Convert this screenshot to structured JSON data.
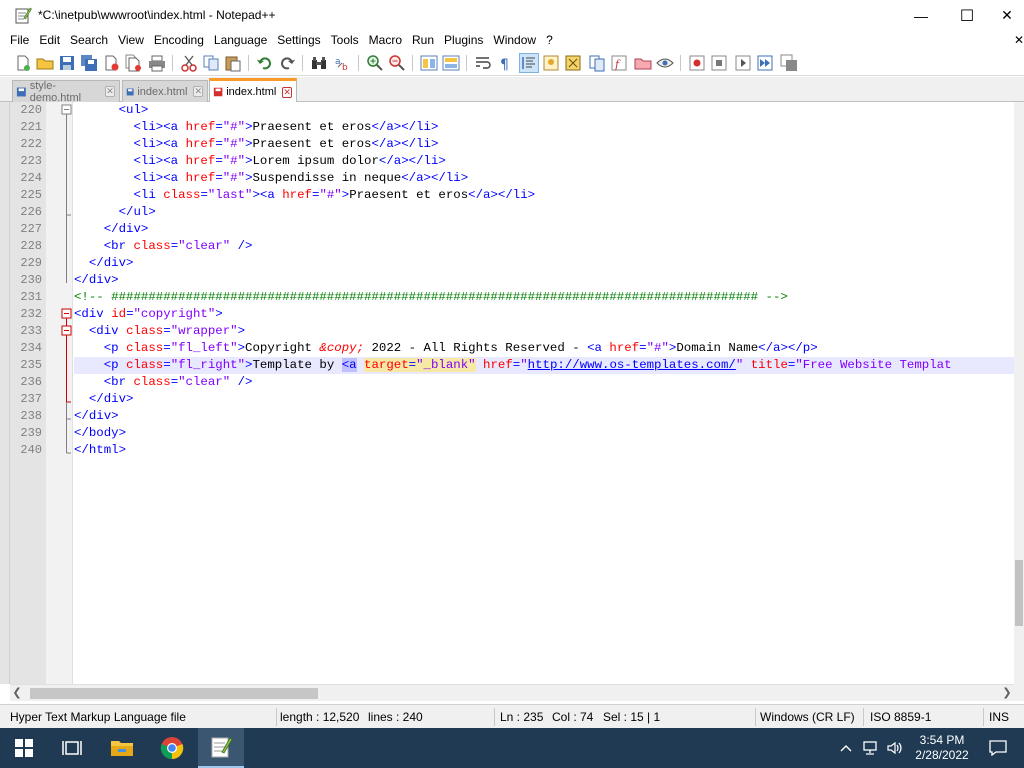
{
  "window": {
    "title": "*C:\\inetpub\\wwwroot\\index.html - Notepad++",
    "minimize_glyph": "—",
    "maximize_glyph": "☐",
    "close_glyph": "✕"
  },
  "menu": {
    "items": [
      "File",
      "Edit",
      "Search",
      "View",
      "Encoding",
      "Language",
      "Settings",
      "Tools",
      "Macro",
      "Run",
      "Plugins",
      "Window",
      "?"
    ],
    "close_glyph": "✕"
  },
  "tabs": [
    {
      "label": "style-demo.html",
      "active": false
    },
    {
      "label": "index.html",
      "active": false
    },
    {
      "label": "index.html",
      "active": true
    }
  ],
  "editor": {
    "line_numbers": [
      "220",
      "221",
      "222",
      "223",
      "224",
      "225",
      "226",
      "227",
      "228",
      "229",
      "230",
      "231",
      "232",
      "233",
      "234",
      "235",
      "236",
      "237",
      "238",
      "239",
      "240"
    ],
    "lines": [
      "      <ul>",
      "        <li><a href=\"#\">Praesent et eros</a></li>",
      "        <li><a href=\"#\">Praesent et eros</a></li>",
      "        <li><a href=\"#\">Lorem ipsum dolor</a></li>",
      "        <li><a href=\"#\">Suspendisse in neque</a></li>",
      "        <li class=\"last\"><a href=\"#\">Praesent et eros</a></li>",
      "      </ul>",
      "    </div>",
      "    <br class=\"clear\" />",
      "  </div>",
      "</div>",
      "<!-- ####################################################################################### -->",
      "<div id=\"copyright\">",
      "  <div class=\"wrapper\">",
      "    <p class=\"fl_left\">Copyright &copy; 2022 - All Rights Reserved - <a href=\"#\">Domain Name</a></p>",
      "    <p class=\"fl_right\">Template by <a target=\"_blank\" href=\"http://www.os-templates.com/\" title=\"Free Website Templat",
      "    <br class=\"clear\" />",
      "  </div>",
      "</div>",
      "</body>",
      "</html>"
    ],
    "current_line_index": 15
  },
  "status": {
    "file_type": "Hyper Text Markup Language file",
    "length": "length : 12,520",
    "lines": "lines : 240",
    "ln": "Ln : 235",
    "col": "Col : 74",
    "sel": "Sel : 15 | 1",
    "eol": "Windows (CR LF)",
    "encoding": "ISO 8859-1",
    "mode": "INS"
  },
  "taskbar": {
    "time": "3:54 PM",
    "date": "2/28/2022"
  },
  "colors": {
    "tag": "#0000ff",
    "attribute": "#ff0000",
    "value": "#8000ff",
    "comment": "#008000",
    "active_tab_accent": "#fa9b28",
    "taskbar": "#1f3a52"
  }
}
